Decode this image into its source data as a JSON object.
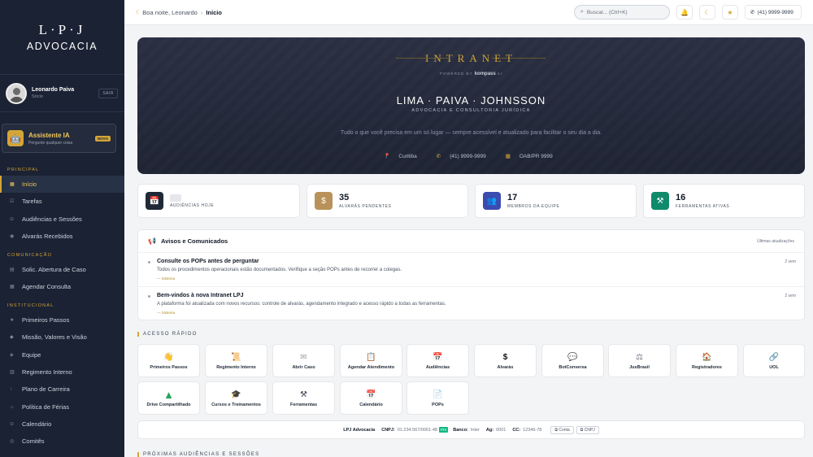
{
  "brand": {
    "mark": "L·P·J",
    "name": "ADVOCACIA"
  },
  "user": {
    "name": "Leonardo Paiva",
    "role": "Sócio",
    "logout": "SAIR"
  },
  "assistant": {
    "title": "Assistente IA",
    "subtitle": "Pergunte qualquer coisa",
    "badge": "NOVO"
  },
  "nav": {
    "sections": {
      "principal": "PRINCIPAL",
      "comunicacao": "COMUNICAÇÃO",
      "institucional": "INSTITUCIONAL"
    },
    "items": [
      {
        "label": "Início",
        "icon": "grid-icon"
      },
      {
        "label": "Tarefas",
        "icon": "check-icon"
      },
      {
        "label": "Audiências e Sessões",
        "icon": "gavel-icon"
      },
      {
        "label": "Alvarás Recebidos",
        "icon": "document-icon"
      },
      {
        "label": "Solic. Abertura de Caso",
        "icon": "folder-icon"
      },
      {
        "label": "Agendar Consulta",
        "icon": "calendar-icon"
      },
      {
        "label": "Primeiros Passos",
        "icon": "star-icon"
      },
      {
        "label": "Missão, Valores e Visão",
        "icon": "diamond-icon"
      },
      {
        "label": "Equipe",
        "icon": "users-icon"
      },
      {
        "label": "Regimento Interno",
        "icon": "book-icon"
      },
      {
        "label": "Plano de Carreira",
        "icon": "arrow-up-icon"
      },
      {
        "label": "Política de Férias",
        "icon": "sun-icon"
      },
      {
        "label": "Calendário",
        "icon": "calendar-icon"
      },
      {
        "label": "Comitês",
        "icon": "circle-icon"
      }
    ]
  },
  "topbar": {
    "greeting": "Boa noite, Leonardo",
    "separator": "›",
    "current": "Início",
    "search_placeholder": "Buscar... (Ctrl+K)",
    "phone": "(41) 9999-9999"
  },
  "hero": {
    "title": "INTRANET",
    "powered_prefix": "POWERED BY",
    "powered_brand": "kompass",
    "powered_suffix": "AI",
    "firm": "LIMA · PAIVA · JOHNSSON",
    "firm_sub": "ADVOCACIA E CONSULTORIA JURÍDICA",
    "tagline": "Tudo o que você precisa em um só lugar — sempre acessível e atualizado para facilitar o seu dia a dia.",
    "city": "Curitiba",
    "phone": "(41) 9999-9999",
    "oab": "OAB/PR 9999"
  },
  "stats": [
    {
      "value": "",
      "label": "AUDIÊNCIAS HOJE",
      "icon": "calendar-icon",
      "color": "#1f2937"
    },
    {
      "value": "35",
      "label": "ALVARÁS PENDENTES",
      "icon": "dollar-icon",
      "color": "#b8925a"
    },
    {
      "value": "17",
      "label": "MEMBROS DA EQUIPE",
      "icon": "users-icon",
      "color": "#3b4bb0"
    },
    {
      "value": "16",
      "label": "FERRAMENTAS ATIVAS",
      "icon": "tools-icon",
      "color": "#0f8a6a"
    }
  ],
  "announcements": {
    "title": "Avisos e Comunicados",
    "meta": "Últimas atualizações",
    "items": [
      {
        "title": "Consulte os POPs antes de perguntar",
        "desc": "Todos os procedimentos operacionais estão documentados. Verifique a seção POPs antes de recorrer a colegas.",
        "author": "— Sistema",
        "when": "2 sem"
      },
      {
        "title": "Bem-vindos à nova Intranet LPJ",
        "desc": "A plataforma foi atualizada com novos recursos: controle de alvarás, agendamento integrado e acesso rápido a todas as ferramentas.",
        "author": "— Sistema",
        "when": "2 sem"
      }
    ]
  },
  "quick_access": {
    "title": "ACESSO RÁPIDO",
    "tiles": [
      {
        "label": "Primeiros Passos",
        "icon": "wave-hand-icon",
        "glyph": "👋"
      },
      {
        "label": "Regimento Interno",
        "icon": "scroll-icon",
        "glyph": "📜"
      },
      {
        "label": "Abrir Caso",
        "icon": "envelope-icon",
        "glyph": "✉"
      },
      {
        "label": "Agendar Atendimento",
        "icon": "clipboard-icon",
        "glyph": "📋"
      },
      {
        "label": "Audiências",
        "icon": "calendar-icon",
        "glyph": "📅"
      },
      {
        "label": "Alvarás",
        "icon": "dollar-icon",
        "glyph": "$"
      },
      {
        "label": "BotConversa",
        "icon": "chat-icon",
        "glyph": "💬"
      },
      {
        "label": "JusBrasil",
        "icon": "scales-icon",
        "glyph": "⚖"
      },
      {
        "label": "Registradores",
        "icon": "house-icon",
        "glyph": "🏠"
      },
      {
        "label": "UOL",
        "icon": "link-icon",
        "glyph": "🔗"
      },
      {
        "label": "Drive Compartilhado",
        "icon": "drive-icon",
        "glyph": "▲"
      },
      {
        "label": "Cursos e Treinamentos",
        "icon": "graduation-icon",
        "glyph": "🎓"
      },
      {
        "label": "Ferramentas",
        "icon": "tools-icon",
        "glyph": "⚒"
      },
      {
        "label": "Calendário",
        "icon": "calendar-icon",
        "glyph": "📅"
      },
      {
        "label": "POPs",
        "icon": "document-icon",
        "glyph": "📄"
      }
    ]
  },
  "bank": {
    "company": "LPJ Advocacia",
    "cnpj_label": "CNPJ:",
    "cnpj": "01.234.567/0001-48",
    "pix": "PIX",
    "bank_label": "Banco:",
    "bank": "Inter",
    "ag_label": "Ag:",
    "ag": "0001",
    "cc_label": "CC:",
    "cc": "12346-78",
    "copy_account": "Conta",
    "copy_cnpj": "CNPJ"
  },
  "next_section": "PRÓXIMAS AUDIÊNCIAS E SESSÕES",
  "colors": {
    "accent": "#d4a537",
    "sidebar": "#1b2233",
    "hero": "#262c3d"
  }
}
